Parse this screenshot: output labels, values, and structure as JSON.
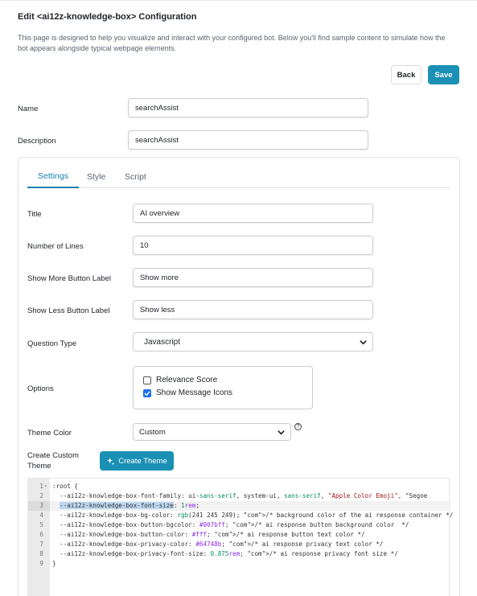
{
  "header": {
    "title": "Edit <ai12z-knowledge-box> Configuration",
    "description": "This page is designed to help you visualize and interact with your configured bot. Below you'll find sample content to simulate how the bot appears alongside typical webpage elements."
  },
  "actions": {
    "back_label": "Back",
    "save_label": "Save"
  },
  "fields": {
    "name": {
      "label": "Name",
      "value": "searchAssist"
    },
    "description": {
      "label": "Description",
      "value": "searchAssist"
    }
  },
  "tabs": [
    {
      "label": "Settings",
      "active": true
    },
    {
      "label": "Style",
      "active": false
    },
    {
      "label": "Script",
      "active": false
    }
  ],
  "settings": {
    "title": {
      "label": "Title",
      "value": "AI overview"
    },
    "number_of_lines": {
      "label": "Number of Lines",
      "value": "10"
    },
    "show_more": {
      "label": "Show More Button Label",
      "value": "Show more"
    },
    "show_less": {
      "label": "Show Less Button Label",
      "value": "Show less"
    },
    "question_type": {
      "label": "Question Type",
      "value": "Javascript"
    },
    "options": {
      "label": "Options",
      "items": [
        {
          "label": "Relevance Score",
          "checked": false
        },
        {
          "label": "Show Message Icons",
          "checked": true
        }
      ]
    },
    "theme_color": {
      "label": "Theme Color",
      "value": "Custom",
      "help": "?"
    },
    "custom_theme": {
      "label": "Create Custom Theme",
      "button_label": "Create Theme"
    }
  },
  "editor": {
    "active_line": 3,
    "lines": [
      ":root {",
      "  --ai12z-knowledge-box-font-family: ui-sans-serif, system-ui, sans-serif, \"Apple Color Emoji\", \"Segoe",
      "  --ai12z-knowledge-box-font-size: 1rem;",
      "  --ai12z-knowledge-box-bg-color: rgb(241 245 249); /* background color of the ai response container */",
      "  --ai12z-knowledge-box-button-bgcolor: #007bff; /* ai response button background color  */",
      "  --ai12z-knowledge-box-button-color: #fff; /* ai response button text color */",
      "  --ai12z-knowledge-box-privacy-color: #64748b; /* ai response privacy text color */",
      "  --ai12z-knowledge-box-privacy-font-size: 0.875rem; /* ai response privacy font size */",
      "}"
    ]
  },
  "colors": {
    "accent": "#1a90b4",
    "tab_active": "#1a7fb0",
    "checkbox": "#1a73e8"
  }
}
